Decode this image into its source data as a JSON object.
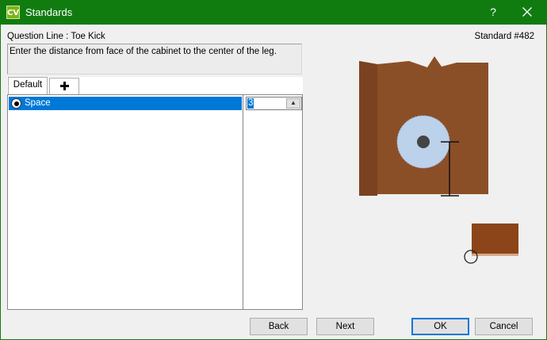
{
  "window": {
    "icon_text": "CV",
    "title": "Standards",
    "help_label": "?"
  },
  "question": {
    "label": "Question Line : Toe Kick",
    "standard": "Standard #482",
    "description": "Enter the distance  from face of the cabinet to the center of the leg."
  },
  "tabs": [
    {
      "label": "Default",
      "active": true
    }
  ],
  "grid": {
    "rows": [
      {
        "name": "Space",
        "value": "3",
        "selected": true
      }
    ]
  },
  "buttons": {
    "back": "Back",
    "next": "Next",
    "ok": "OK",
    "cancel": "Cancel"
  },
  "colors": {
    "titlebar": "#107c10",
    "selection": "#0078d7",
    "cabinet": "#8b4f28",
    "leg": "#bcd1ea"
  },
  "icons": [
    "close-icon",
    "plus-icon",
    "radio-selected-icon",
    "dropdown-icon"
  ]
}
